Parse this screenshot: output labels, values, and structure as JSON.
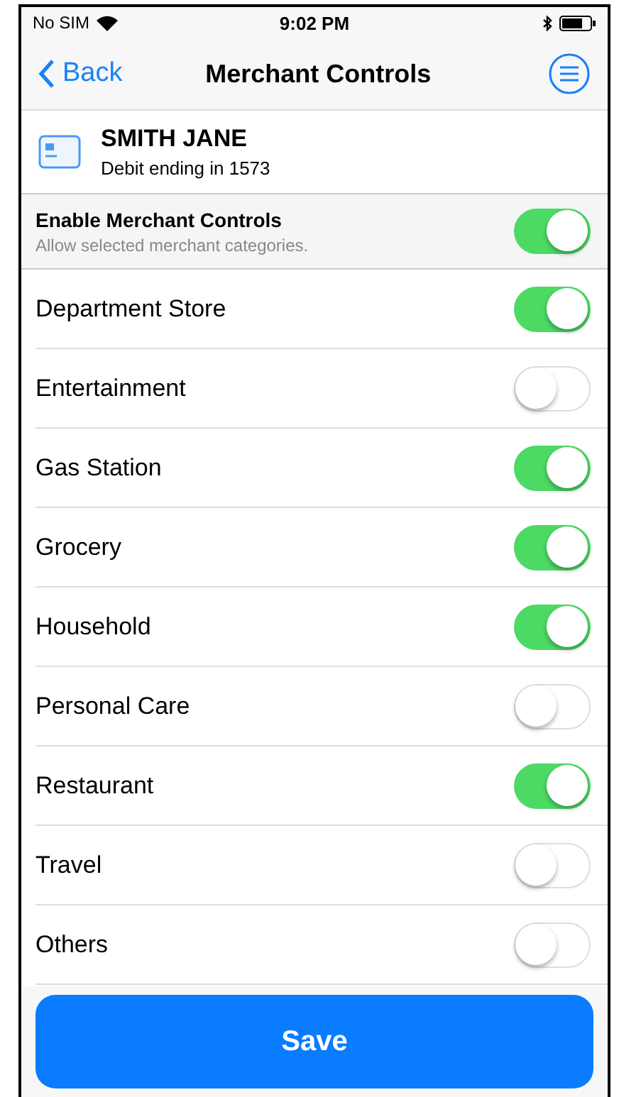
{
  "status_bar": {
    "carrier": "No SIM",
    "time": "9:02 PM"
  },
  "nav": {
    "back": "Back",
    "title": "Merchant Controls"
  },
  "card": {
    "name": "SMITH JANE",
    "detail": "Debit ending in 1573"
  },
  "master": {
    "label": "Enable Merchant Controls",
    "hint": "Allow selected merchant categories.",
    "on": true
  },
  "categories": [
    {
      "label": "Department Store",
      "on": true
    },
    {
      "label": "Entertainment",
      "on": false
    },
    {
      "label": "Gas Station",
      "on": true
    },
    {
      "label": "Grocery",
      "on": true
    },
    {
      "label": "Household",
      "on": true
    },
    {
      "label": "Personal Care",
      "on": false
    },
    {
      "label": "Restaurant",
      "on": true
    },
    {
      "label": "Travel",
      "on": false
    },
    {
      "label": "Others",
      "on": false
    }
  ],
  "save": "Save"
}
